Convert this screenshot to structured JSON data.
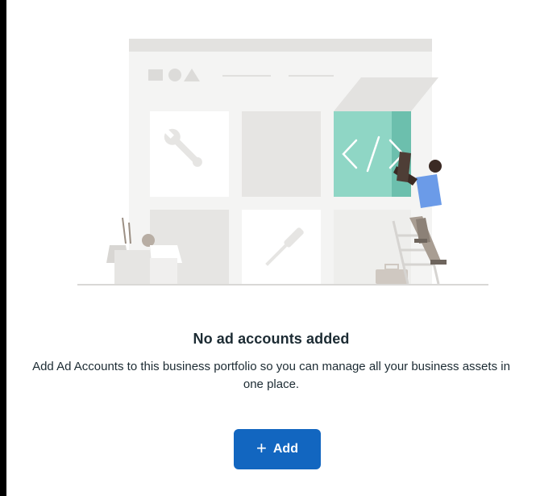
{
  "empty_state": {
    "title": "No ad accounts added",
    "description": "Add Ad Accounts to this business portfolio so you can manage all your business assets in one place.",
    "illustration_icon": "code-brackets-icon"
  },
  "actions": {
    "add_label": "Add",
    "add_icon": "plus-icon"
  },
  "colors": {
    "accent": "#1266c0",
    "illustration_teal": "#8fd6c5",
    "illustration_gray": "#e6e5e3"
  }
}
